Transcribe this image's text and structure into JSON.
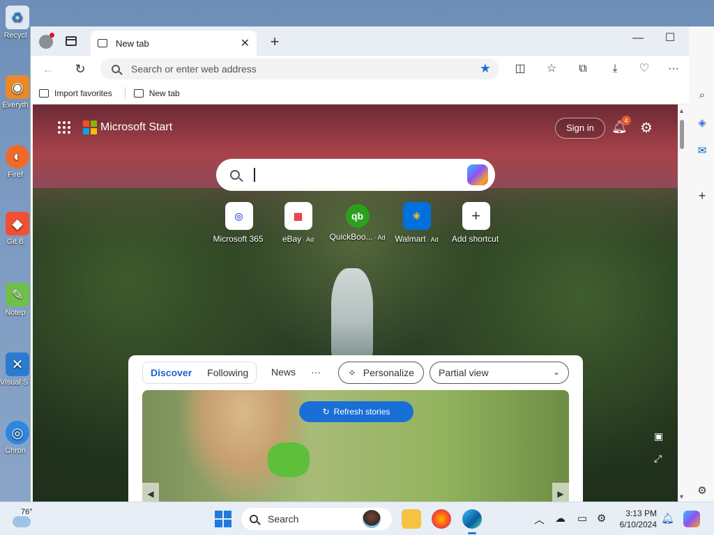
{
  "desktop": {
    "icons": [
      {
        "label": "Recycl",
        "color": "#dfe8f2"
      },
      {
        "label": "Everyth",
        "color": "#e98a2a"
      },
      {
        "label": "Firef",
        "color": "#ef6a2a"
      },
      {
        "label": "Git B",
        "color": "#f05033"
      },
      {
        "label": "Notep",
        "color": "#6fbf49"
      },
      {
        "label": "Visual S Co",
        "color": "#2b7bd0"
      },
      {
        "label": "Chron",
        "color": "#2d86e0"
      }
    ]
  },
  "browser": {
    "tab": {
      "title": "New tab",
      "close": "✕"
    },
    "new_tab_button": "+",
    "window_controls": {
      "minimize": "—",
      "maximize": "☐",
      "close": "✕"
    },
    "nav": {
      "back": "←",
      "refresh": "↻"
    },
    "address": {
      "placeholder": "Search or enter web address"
    },
    "favorites": [
      {
        "label": "Import favorites"
      },
      {
        "label": "New tab"
      }
    ]
  },
  "page": {
    "brand": "Microsoft Start",
    "sign_in": "Sign in",
    "notification_count": "4",
    "search_value": "",
    "shortcuts": [
      {
        "label": "Microsoft 365",
        "ad": "",
        "tile": "◎",
        "color": "#5b6ee8"
      },
      {
        "label": "eBay",
        "ad": "· Ad",
        "tile": "▦",
        "color": "#e53238"
      },
      {
        "label": "QuickBoo...",
        "ad": "· Ad",
        "tile": "qb",
        "color": "#2ca01c"
      },
      {
        "label": "Walmart",
        "ad": "· Ad",
        "tile": "✳",
        "color": "#0071dc"
      },
      {
        "label": "Add shortcut",
        "ad": "",
        "tile": "+",
        "color": "#333333"
      }
    ],
    "feed": {
      "tabs": [
        {
          "label": "Discover",
          "active": true
        },
        {
          "label": "Following",
          "active": false
        }
      ],
      "news": "News",
      "more": "···",
      "personalize": "Personalize",
      "view": "Partial view",
      "refresh": "Refresh stories"
    }
  },
  "taskbar": {
    "temperature": "76°",
    "search": "Search",
    "time": "3:13 PM",
    "date": "6/10/2024"
  }
}
